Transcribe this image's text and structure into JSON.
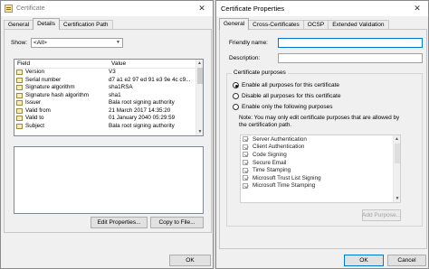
{
  "cert": {
    "title": "Certificate",
    "tabs": [
      "General",
      "Details",
      "Certification Path"
    ],
    "show_label": "Show:",
    "show_value": "<All>",
    "columns": [
      "Field",
      "Value"
    ],
    "rows": [
      {
        "field": "Version",
        "value": "V3"
      },
      {
        "field": "Serial number",
        "value": "d7 a1 e2 97 ed 91 e3 9e 4c c9..."
      },
      {
        "field": "Signature algorithm",
        "value": "sha1RSA"
      },
      {
        "field": "Signature hash algorithm",
        "value": "sha1"
      },
      {
        "field": "Issuer",
        "value": "Bala root signing authority"
      },
      {
        "field": "Valid from",
        "value": "21 March 2017 14:35:20"
      },
      {
        "field": "Valid to",
        "value": "01 January 2040 05:29:59"
      },
      {
        "field": "Subject",
        "value": "Bala root signing authority"
      }
    ],
    "edit_button": "Edit Properties...",
    "copy_button": "Copy to File...",
    "ok_button": "OK"
  },
  "props": {
    "title": "Certificate Properties",
    "tabs": [
      "General",
      "Cross-Certificates",
      "OCSP",
      "Extended Validation"
    ],
    "friendly_label": "Friendly name:",
    "friendly_value": "",
    "description_label": "Description:",
    "description_value": "",
    "group_title": "Certificate purposes",
    "radio1": "Enable all purposes for this certificate",
    "radio2": "Disable all purposes for this certificate",
    "radio3": "Enable only the following purposes",
    "note_line1": "Note: You may only edit certificate purposes that are allowed by",
    "note_line2": "the certification path.",
    "purposes": [
      "Server Authentication",
      "Client Authentication",
      "Code Signing",
      "Secure Email",
      "Time Stamping",
      "Microsoft Trust List Signing",
      "Microsoft Time Stamping"
    ],
    "add_button": "Add Purpose...",
    "ok_button": "OK",
    "cancel_button": "Cancel"
  },
  "icons": {
    "close": "close-icon",
    "certificate": "certificate-icon",
    "dropdown": "chevron-down-icon"
  },
  "colors": {
    "focus_border": "#0078d7"
  }
}
